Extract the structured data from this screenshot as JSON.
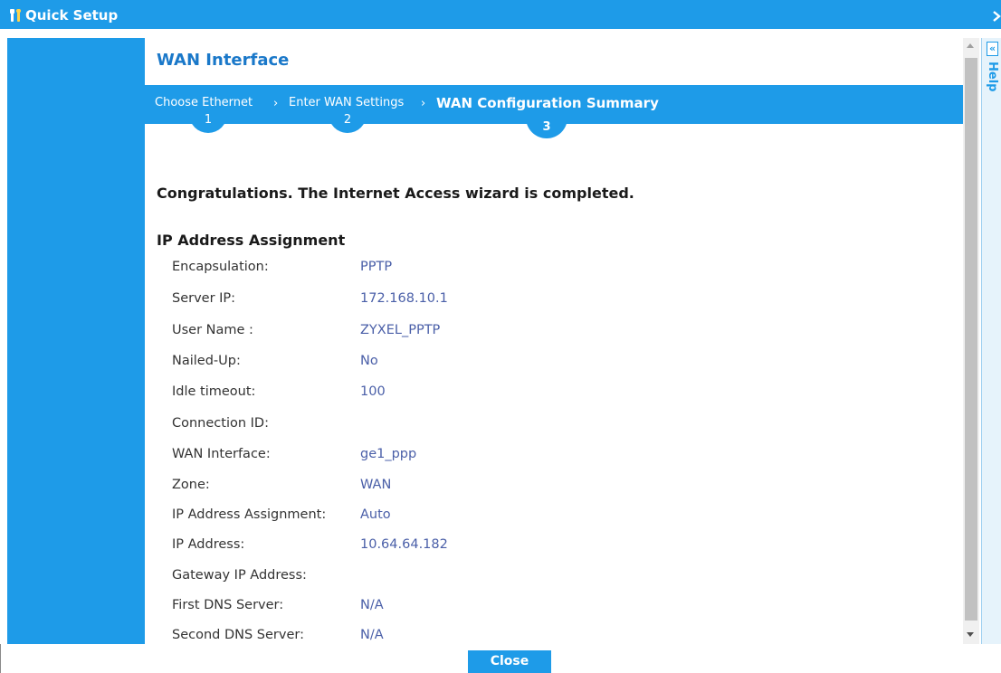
{
  "window": {
    "title": "Quick Setup",
    "accent_color": "#1e9be8",
    "title_icon": "tools-icon"
  },
  "page": {
    "heading": "WAN Interface"
  },
  "steps": [
    {
      "label": "Choose Ethernet",
      "number": "1"
    },
    {
      "label": "Enter WAN Settings",
      "number": "2"
    },
    {
      "label": "WAN Configuration Summary",
      "number": "3"
    }
  ],
  "summary": {
    "message": "Congratulations. The Internet Access wizard is completed.",
    "section_title": "IP Address Assignment",
    "rows": [
      {
        "label": "Encapsulation:",
        "value": "PPTP"
      },
      {
        "label": "Server IP:",
        "value": "172.168.10.1"
      },
      {
        "label": "User Name :",
        "value": "ZYXEL_PPTP"
      },
      {
        "label": "Nailed-Up:",
        "value": "No"
      },
      {
        "label": "Idle timeout:",
        "value": "100"
      },
      {
        "label": "Connection ID:",
        "value": ""
      },
      {
        "label": "WAN Interface:",
        "value": "ge1_ppp"
      },
      {
        "label": "Zone:",
        "value": "WAN"
      },
      {
        "label": "IP Address Assignment:",
        "value": "Auto"
      },
      {
        "label": "IP Address:",
        "value": "10.64.64.182"
      },
      {
        "label": "Gateway IP Address:",
        "value": ""
      },
      {
        "label": "First DNS Server:",
        "value": "N/A"
      },
      {
        "label": "Second DNS Server:",
        "value": "N/A"
      }
    ]
  },
  "help": {
    "label": "Help",
    "collapse_icon": "double-chevron-left-icon"
  },
  "footer": {
    "close_label": "Close"
  }
}
